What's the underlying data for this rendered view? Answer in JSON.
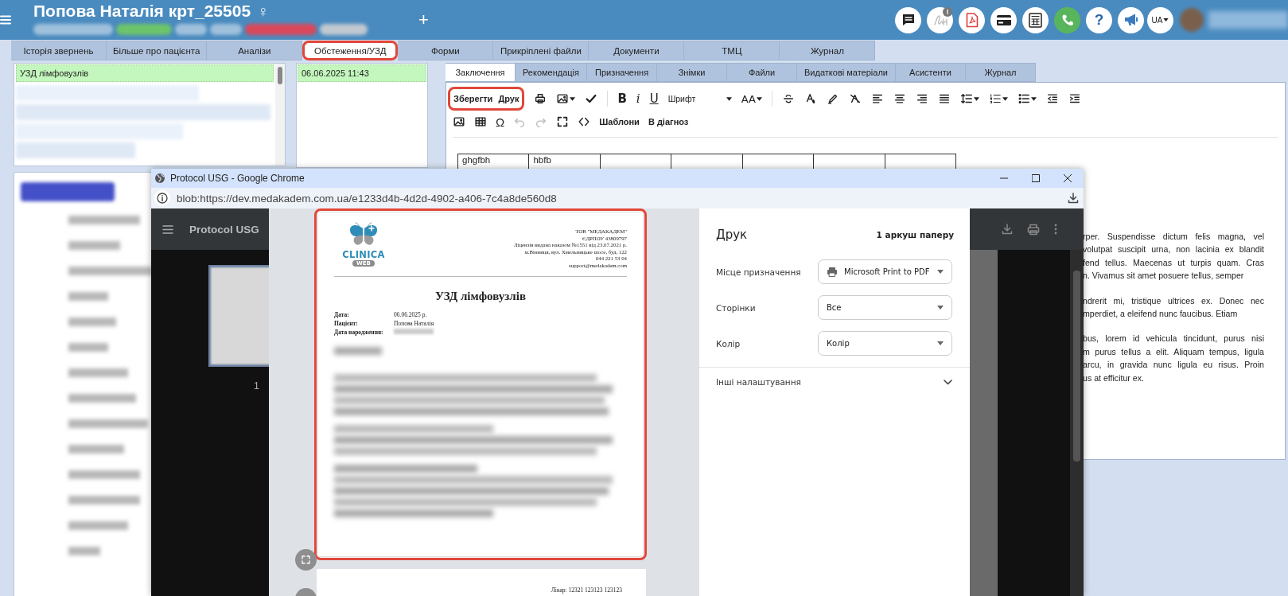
{
  "header": {
    "title": "Попова Наталія крт_25505",
    "gender_symbol": "♀",
    "add_label": "+",
    "actions": [
      {
        "kind": "chat"
      },
      {
        "kind": "signature",
        "badge": "!"
      },
      {
        "kind": "pdf"
      },
      {
        "kind": "card"
      },
      {
        "kind": "calculator"
      },
      {
        "kind": "phone"
      },
      {
        "kind": "help",
        "label": "?"
      },
      {
        "kind": "announce"
      }
    ],
    "language": "UA"
  },
  "main_tabs": [
    {
      "label": "Історія звернень",
      "selected": false,
      "highlighted": false
    },
    {
      "label": "Більше про пацієнта",
      "selected": false,
      "highlighted": false
    },
    {
      "label": "Аналізи",
      "selected": false,
      "highlighted": false
    },
    {
      "label": "Обстеження/УЗД",
      "selected": true,
      "highlighted": true
    },
    {
      "label": "Форми",
      "selected": false,
      "highlighted": false
    },
    {
      "label": "Прикріплені файли",
      "selected": false,
      "highlighted": false
    },
    {
      "label": "Документи",
      "selected": false,
      "highlighted": false
    },
    {
      "label": "ТМЦ",
      "selected": false,
      "highlighted": false
    },
    {
      "label": "Журнал",
      "selected": false,
      "highlighted": false
    }
  ],
  "studies": [
    {
      "label": "УЗД лімфовузлів",
      "selected": true
    }
  ],
  "dates": [
    {
      "label": "06.06.2025 11:43",
      "selected": true
    }
  ],
  "editor": {
    "tabs": [
      {
        "label": "Заключення",
        "selected": true
      },
      {
        "label": "Рекомендація",
        "selected": false
      },
      {
        "label": "Призначення",
        "selected": false
      },
      {
        "label": "Знімки",
        "selected": false
      },
      {
        "label": "Файли",
        "selected": false
      },
      {
        "label": "Видаткові матеріали",
        "selected": false
      },
      {
        "label": "Асистенти",
        "selected": false
      },
      {
        "label": "Журнал",
        "selected": false
      }
    ],
    "toolbar_rows": [
      [
        {
          "kind": "group",
          "highlighted": true,
          "items": [
            {
              "kind": "text",
              "label": "Зберегти"
            },
            {
              "kind": "text",
              "label": "Друк"
            }
          ]
        },
        {
          "kind": "print"
        },
        {
          "kind": "image",
          "dropdown": true
        },
        {
          "kind": "check"
        },
        {
          "kind": "bold",
          "label": "B"
        },
        {
          "kind": "italic",
          "label": "i"
        },
        {
          "kind": "underline",
          "label": "U"
        },
        {
          "kind": "select",
          "label": "Шрифт",
          "dropdown": true
        },
        {
          "kind": "size",
          "label": "AA",
          "dropdown": true
        },
        {
          "kind": "strike"
        },
        {
          "kind": "fontcolor"
        },
        {
          "kind": "highlight"
        },
        {
          "kind": "clearformat"
        },
        {
          "kind": "alignleft"
        },
        {
          "kind": "aligncenter"
        },
        {
          "kind": "alignright"
        },
        {
          "kind": "justify"
        },
        {
          "kind": "lineheight",
          "dropdown": true
        },
        {
          "kind": "ol",
          "dropdown": true
        },
        {
          "kind": "ul",
          "dropdown": true
        },
        {
          "kind": "outdent"
        },
        {
          "kind": "indent"
        }
      ],
      [
        {
          "kind": "image",
          "disabled": false
        },
        {
          "kind": "table",
          "disabled": false
        },
        {
          "kind": "symbol",
          "label": "Ω",
          "disabled": false
        },
        {
          "kind": "undo",
          "disabled": true
        },
        {
          "kind": "redo",
          "disabled": true
        },
        {
          "kind": "fullscreen",
          "disabled": false
        },
        {
          "kind": "code",
          "disabled": false
        },
        {
          "kind": "text",
          "label": "Шаблони",
          "disabled": false
        },
        {
          "kind": "text",
          "label": "В діагноз",
          "disabled": false
        }
      ]
    ],
    "table_row": [
      "ghgfbh",
      "hbfb"
    ],
    "paragraphs": [
      [
        "rper. Suspendisse dictum felis magna, vel",
        "volutpat suscipit urna, non lacinia ex blandit",
        "fend tellus. Maecenas ut turpis quam. Cras",
        "n. Vivamus sit amet posuere tellus, semper"
      ],
      [
        "ndrerit mi, tristique ultrices ex. Donec nec",
        "mperdiet, a eleifend nunc faucibus. Etiam"
      ],
      [
        "bus, lorem id vehicula tincidunt, purus nisi",
        "m purus tellus a elit. Aliquam tempus, ligula",
        "arcu, in gravida nunc ligula eu risus. Proin",
        "us at efficitur ex."
      ]
    ]
  },
  "popup": {
    "title": "Protocol USG - Google Chrome",
    "url": "blob:https://dev.medakadem.com.ua/e1233d4b-4d2d-4902-a406-7c4a8de560d8",
    "viewer_title": "Protocol USG",
    "page_number": "1",
    "page": {
      "highlighted": true,
      "logo_text": "CLINICA",
      "logo_badge": "WEB",
      "company_lines": [
        "ТОВ \"МЕДАКАДЕМ\"",
        "ЄДРПОУ 43809797",
        "Ліцензія видана наказом №1551 від 23.07.2021 р.",
        "м.Вінниця, вул. Хмельницьке шосе, буд. 122",
        "044 221 53 04",
        "support@medakadem.com"
      ],
      "title": "УЗД лімфовузлів",
      "fields": [
        {
          "label": "Дата:",
          "value": "06.06.2025 р."
        },
        {
          "label": "Пацієнт:",
          "value": "Попова Наталія"
        },
        {
          "label": "Дата народження:"
        }
      ]
    },
    "next_page_footer": "Лікар: 12321 123123 123123",
    "print": {
      "title": "Друк",
      "sheets": "1 аркуш паперу",
      "settings": [
        {
          "label": "Місце призначення",
          "value": "Microsoft Print to PDF",
          "kind": "printer"
        },
        {
          "label": "Сторінки",
          "value": "Все",
          "kind": "plain"
        },
        {
          "label": "Колір",
          "value": "Колір",
          "kind": "plain"
        }
      ],
      "more": "Інші налаштування",
      "more_expanded": false
    }
  }
}
